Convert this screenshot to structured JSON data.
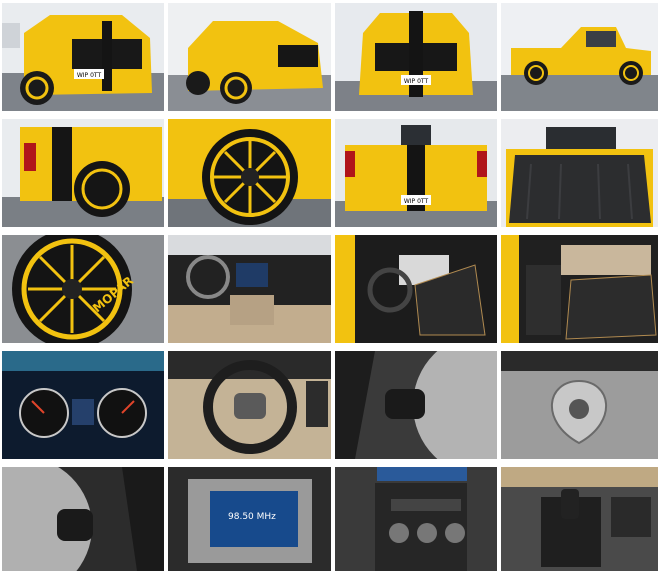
{
  "gallery": {
    "plate_text": "WIP 0TT",
    "brand_text": "MOPAR",
    "radio_readout": "98.50 MHz"
  },
  "colors": {
    "yellow": "#f2c210",
    "black": "#141414",
    "interior_dark": "#1e1e1e",
    "interior_tan": "#b9a58a",
    "floor_gray": "#8d9096",
    "wall_white": "#eceff2"
  }
}
